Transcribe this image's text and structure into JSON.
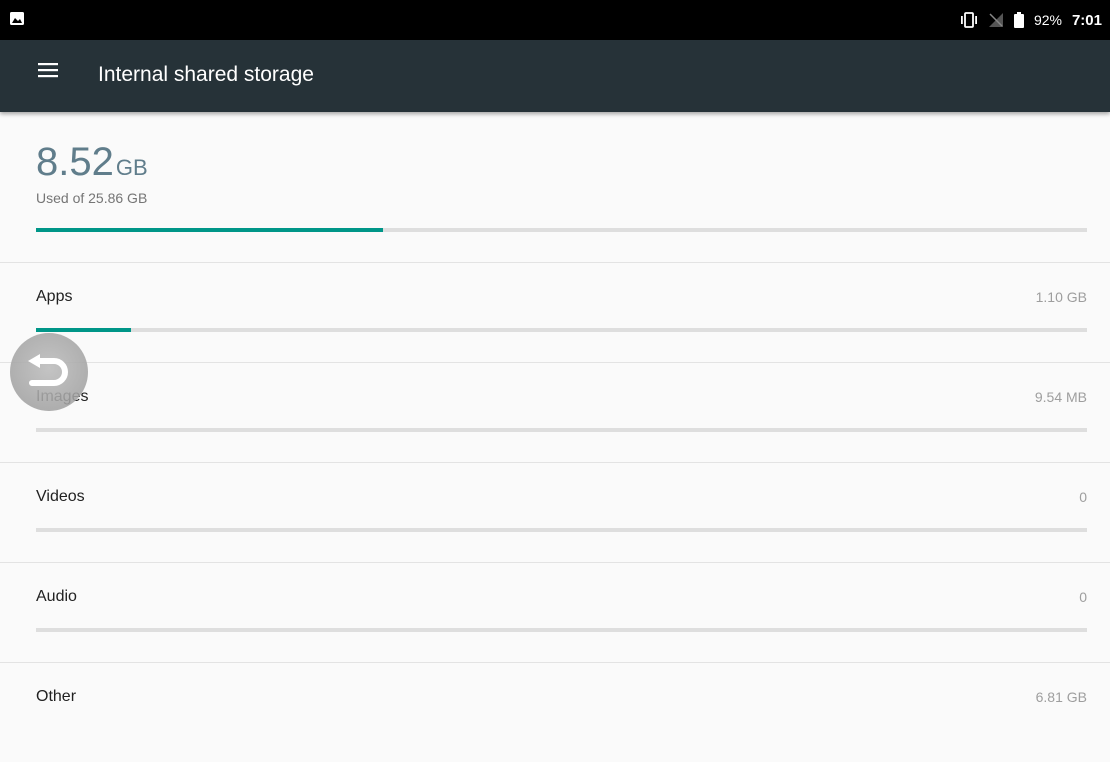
{
  "status_bar": {
    "left_icon": "image-notification-icon",
    "icons": [
      "vibrate-icon",
      "no-signal-icon",
      "battery-icon"
    ],
    "battery": "92%",
    "time": "7:01"
  },
  "app_bar": {
    "menu_icon": "menu-icon",
    "title": "Internal shared storage"
  },
  "summary": {
    "used_value": "8.52",
    "used_unit": "GB",
    "used_of_label": "Used of 25.86 GB",
    "used_fraction": 0.33
  },
  "categories": [
    {
      "label": "Apps",
      "size": "1.10 GB",
      "fraction": 0.09
    },
    {
      "label": "Images",
      "size": "9.54 MB",
      "fraction": 0
    },
    {
      "label": "Videos",
      "size": "0",
      "fraction": 0
    },
    {
      "label": "Audio",
      "size": "0",
      "fraction": 0
    },
    {
      "label": "Other",
      "size": "6.81 GB",
      "fraction": 0
    }
  ],
  "floating_button": {
    "icon": "back-arrow-icon"
  },
  "colors": {
    "status_bar": "#000000",
    "app_bar": "#263238",
    "accent": "#009688",
    "track": "#dedede",
    "used_text": "#607d8b"
  }
}
